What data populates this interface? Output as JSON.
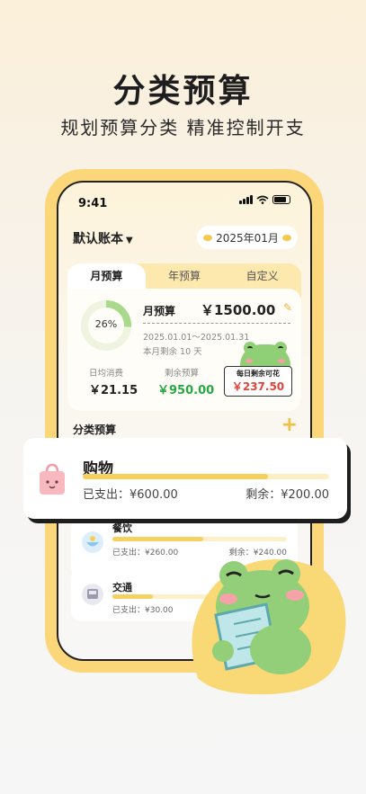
{
  "hero": {
    "title": "分类预算",
    "subtitle": "规划预算分类  精准控制开支"
  },
  "status": {
    "time": "9:41"
  },
  "header": {
    "account": "默认账本",
    "month": "2025年01月"
  },
  "tabs": [
    {
      "label": "月预算",
      "active": true
    },
    {
      "label": "年预算",
      "active": false
    },
    {
      "label": "自定义",
      "active": false
    }
  ],
  "budget": {
    "percent_used": 0.26,
    "percent_label": "26%",
    "label": "月预算",
    "amount": "￥1500.00",
    "range": "2025.01.01～2025.01.31",
    "remaining_days": "本月剩余 10 天",
    "daily_avg_label": "日均消费",
    "daily_avg_value": "￥21.15",
    "remaining_label": "剩余预算",
    "remaining_value": "￥950.00",
    "daily_available_label": "每日剩余可花",
    "daily_available_value": "￥237.50"
  },
  "category_section": {
    "title": "分类预算"
  },
  "categories": [
    {
      "name": "购物",
      "icon": "shopping-bag-icon",
      "progress": 0.75,
      "spent": "已支出：¥600.00",
      "left": "剩余：¥200.00"
    },
    {
      "name": "餐饮",
      "icon": "food-bowl-icon",
      "progress": 0.52,
      "spent": "已支出：¥260.00",
      "left": "剩余：¥240.00"
    },
    {
      "name": "交通",
      "icon": "bus-icon",
      "progress": 0.23,
      "spent": "已支出：¥30.00",
      "left": ""
    }
  ],
  "colors": {
    "accent": "#f7cf5a",
    "green": "#27a844",
    "red": "#e0443a",
    "frog": "#8fcf75"
  }
}
